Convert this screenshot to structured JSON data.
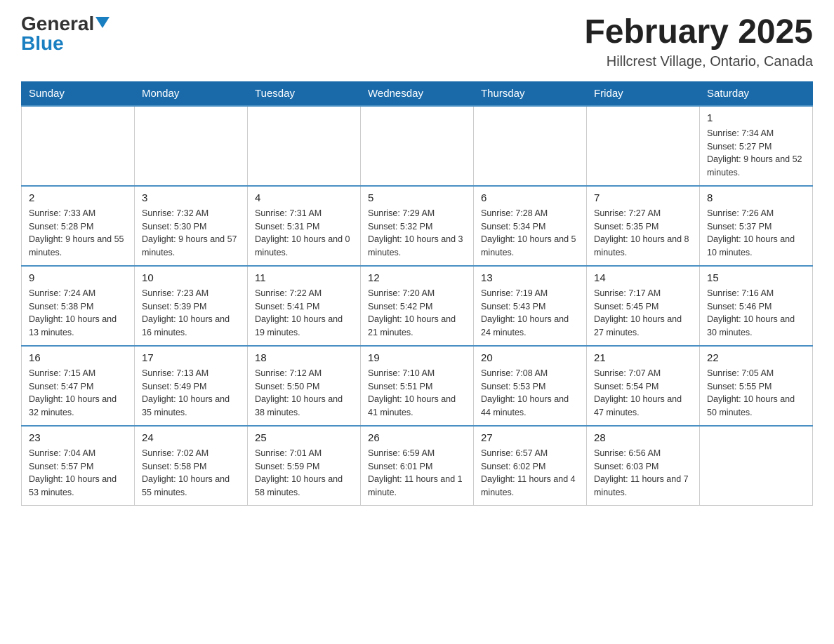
{
  "header": {
    "logo": {
      "general": "General",
      "blue": "Blue",
      "arrow": "▼"
    },
    "title": "February 2025",
    "location": "Hillcrest Village, Ontario, Canada"
  },
  "weekdays": [
    "Sunday",
    "Monday",
    "Tuesday",
    "Wednesday",
    "Thursday",
    "Friday",
    "Saturday"
  ],
  "weeks": [
    [
      {
        "day": "",
        "info": ""
      },
      {
        "day": "",
        "info": ""
      },
      {
        "day": "",
        "info": ""
      },
      {
        "day": "",
        "info": ""
      },
      {
        "day": "",
        "info": ""
      },
      {
        "day": "",
        "info": ""
      },
      {
        "day": "1",
        "info": "Sunrise: 7:34 AM\nSunset: 5:27 PM\nDaylight: 9 hours and 52 minutes."
      }
    ],
    [
      {
        "day": "2",
        "info": "Sunrise: 7:33 AM\nSunset: 5:28 PM\nDaylight: 9 hours and 55 minutes."
      },
      {
        "day": "3",
        "info": "Sunrise: 7:32 AM\nSunset: 5:30 PM\nDaylight: 9 hours and 57 minutes."
      },
      {
        "day": "4",
        "info": "Sunrise: 7:31 AM\nSunset: 5:31 PM\nDaylight: 10 hours and 0 minutes."
      },
      {
        "day": "5",
        "info": "Sunrise: 7:29 AM\nSunset: 5:32 PM\nDaylight: 10 hours and 3 minutes."
      },
      {
        "day": "6",
        "info": "Sunrise: 7:28 AM\nSunset: 5:34 PM\nDaylight: 10 hours and 5 minutes."
      },
      {
        "day": "7",
        "info": "Sunrise: 7:27 AM\nSunset: 5:35 PM\nDaylight: 10 hours and 8 minutes."
      },
      {
        "day": "8",
        "info": "Sunrise: 7:26 AM\nSunset: 5:37 PM\nDaylight: 10 hours and 10 minutes."
      }
    ],
    [
      {
        "day": "9",
        "info": "Sunrise: 7:24 AM\nSunset: 5:38 PM\nDaylight: 10 hours and 13 minutes."
      },
      {
        "day": "10",
        "info": "Sunrise: 7:23 AM\nSunset: 5:39 PM\nDaylight: 10 hours and 16 minutes."
      },
      {
        "day": "11",
        "info": "Sunrise: 7:22 AM\nSunset: 5:41 PM\nDaylight: 10 hours and 19 minutes."
      },
      {
        "day": "12",
        "info": "Sunrise: 7:20 AM\nSunset: 5:42 PM\nDaylight: 10 hours and 21 minutes."
      },
      {
        "day": "13",
        "info": "Sunrise: 7:19 AM\nSunset: 5:43 PM\nDaylight: 10 hours and 24 minutes."
      },
      {
        "day": "14",
        "info": "Sunrise: 7:17 AM\nSunset: 5:45 PM\nDaylight: 10 hours and 27 minutes."
      },
      {
        "day": "15",
        "info": "Sunrise: 7:16 AM\nSunset: 5:46 PM\nDaylight: 10 hours and 30 minutes."
      }
    ],
    [
      {
        "day": "16",
        "info": "Sunrise: 7:15 AM\nSunset: 5:47 PM\nDaylight: 10 hours and 32 minutes."
      },
      {
        "day": "17",
        "info": "Sunrise: 7:13 AM\nSunset: 5:49 PM\nDaylight: 10 hours and 35 minutes."
      },
      {
        "day": "18",
        "info": "Sunrise: 7:12 AM\nSunset: 5:50 PM\nDaylight: 10 hours and 38 minutes."
      },
      {
        "day": "19",
        "info": "Sunrise: 7:10 AM\nSunset: 5:51 PM\nDaylight: 10 hours and 41 minutes."
      },
      {
        "day": "20",
        "info": "Sunrise: 7:08 AM\nSunset: 5:53 PM\nDaylight: 10 hours and 44 minutes."
      },
      {
        "day": "21",
        "info": "Sunrise: 7:07 AM\nSunset: 5:54 PM\nDaylight: 10 hours and 47 minutes."
      },
      {
        "day": "22",
        "info": "Sunrise: 7:05 AM\nSunset: 5:55 PM\nDaylight: 10 hours and 50 minutes."
      }
    ],
    [
      {
        "day": "23",
        "info": "Sunrise: 7:04 AM\nSunset: 5:57 PM\nDaylight: 10 hours and 53 minutes."
      },
      {
        "day": "24",
        "info": "Sunrise: 7:02 AM\nSunset: 5:58 PM\nDaylight: 10 hours and 55 minutes."
      },
      {
        "day": "25",
        "info": "Sunrise: 7:01 AM\nSunset: 5:59 PM\nDaylight: 10 hours and 58 minutes."
      },
      {
        "day": "26",
        "info": "Sunrise: 6:59 AM\nSunset: 6:01 PM\nDaylight: 11 hours and 1 minute."
      },
      {
        "day": "27",
        "info": "Sunrise: 6:57 AM\nSunset: 6:02 PM\nDaylight: 11 hours and 4 minutes."
      },
      {
        "day": "28",
        "info": "Sunrise: 6:56 AM\nSunset: 6:03 PM\nDaylight: 11 hours and 7 minutes."
      },
      {
        "day": "",
        "info": ""
      }
    ]
  ]
}
